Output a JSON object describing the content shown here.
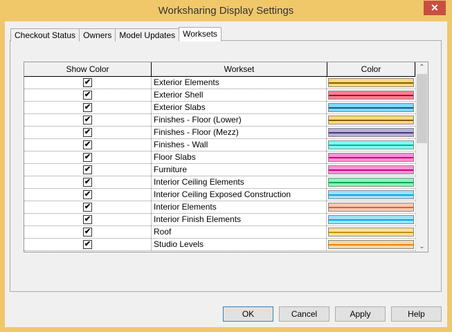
{
  "window": {
    "title": "Worksharing Display Settings",
    "close": "✕"
  },
  "tabs": [
    {
      "label": "Checkout Status"
    },
    {
      "label": "Owners"
    },
    {
      "label": "Model Updates"
    },
    {
      "label": "Worksets"
    }
  ],
  "grid": {
    "headers": [
      "Show Color",
      "Workset",
      "Color"
    ],
    "rows": [
      {
        "name": "Exterior Elements",
        "checked": true,
        "fill": "#ffd97a",
        "line": "#8a5a00"
      },
      {
        "name": "Exterior Shell",
        "checked": true,
        "fill": "#ff8090",
        "line": "#a0102a"
      },
      {
        "name": "Exterior Slabs",
        "checked": true,
        "fill": "#80d8f8",
        "line": "#105a8a"
      },
      {
        "name": "Finishes - Floor (Lower)",
        "checked": true,
        "fill": "#ffd97a",
        "line": "#8a5a00"
      },
      {
        "name": "Finishes - Floor (Mezz)",
        "checked": true,
        "fill": "#b8b0d8",
        "line": "#403880"
      },
      {
        "name": "Finishes - Wall",
        "checked": true,
        "fill": "#80fff0",
        "line": "#00b0a0"
      },
      {
        "name": "Floor Slabs",
        "checked": true,
        "fill": "#ff90d8",
        "line": "#d0007a"
      },
      {
        "name": "Furniture",
        "checked": true,
        "fill": "#ff90d8",
        "line": "#d0007a"
      },
      {
        "name": "Interior Ceiling Elements",
        "checked": true,
        "fill": "#80f8b8",
        "line": "#00a850"
      },
      {
        "name": "Interior Ceiling Exposed Construction",
        "checked": true,
        "fill": "#a0e0f8",
        "line": "#00a8e8"
      },
      {
        "name": "Interior Elements",
        "checked": true,
        "fill": "#f8c8b0",
        "line": "#d86040"
      },
      {
        "name": "Interior Finish Elements",
        "checked": true,
        "fill": "#a0e0f8",
        "line": "#00a8e8"
      },
      {
        "name": "Roof",
        "checked": true,
        "fill": "#ffe098",
        "line": "#c89000"
      },
      {
        "name": "Studio Levels",
        "checked": true,
        "fill": "#ffd8a0",
        "line": "#f08000"
      }
    ]
  },
  "buttons": {
    "ok": "OK",
    "cancel": "Cancel",
    "apply": "Apply",
    "help": "Help"
  }
}
